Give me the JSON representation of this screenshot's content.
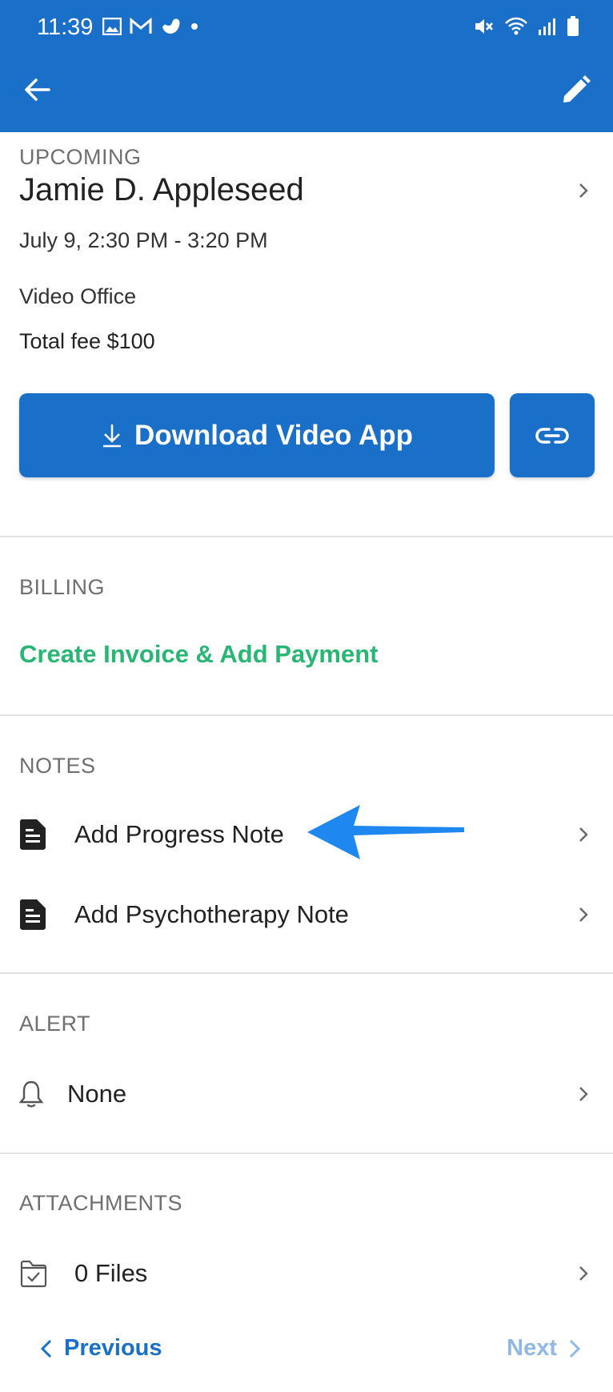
{
  "status_bar": {
    "time": "11:39",
    "icons_left": [
      "image-icon",
      "gmail-icon",
      "app-icon",
      "dot-icon"
    ],
    "icons_right": [
      "mute-icon",
      "wifi-icon",
      "signal-icon",
      "battery-icon"
    ]
  },
  "appbar": {
    "back_icon": "arrow-left-icon",
    "edit_icon": "pencil-icon",
    "color": "#1a6fc9"
  },
  "appointment": {
    "status": "UPCOMING",
    "client_name": "Jamie D. Appleseed",
    "datetime": "July 9, 2:30 PM - 3:20 PM",
    "location": "Video Office",
    "fee": "Total fee $100",
    "download_label": "Download Video App"
  },
  "billing": {
    "heading": "BILLING",
    "action": "Create Invoice & Add Payment",
    "action_color": "#27b673"
  },
  "notes": {
    "heading": "NOTES",
    "items": [
      {
        "label": "Add Progress Note",
        "icon": "document-icon"
      },
      {
        "label": "Add Psychotherapy Note",
        "icon": "document-icon"
      }
    ]
  },
  "alert": {
    "heading": "ALERT",
    "value": "None",
    "icon": "bell-icon"
  },
  "attachments": {
    "heading": "ATTACHMENTS",
    "value": "0 Files",
    "icon": "folder-icon"
  },
  "footer": {
    "previous": "Previous",
    "next": "Next"
  }
}
